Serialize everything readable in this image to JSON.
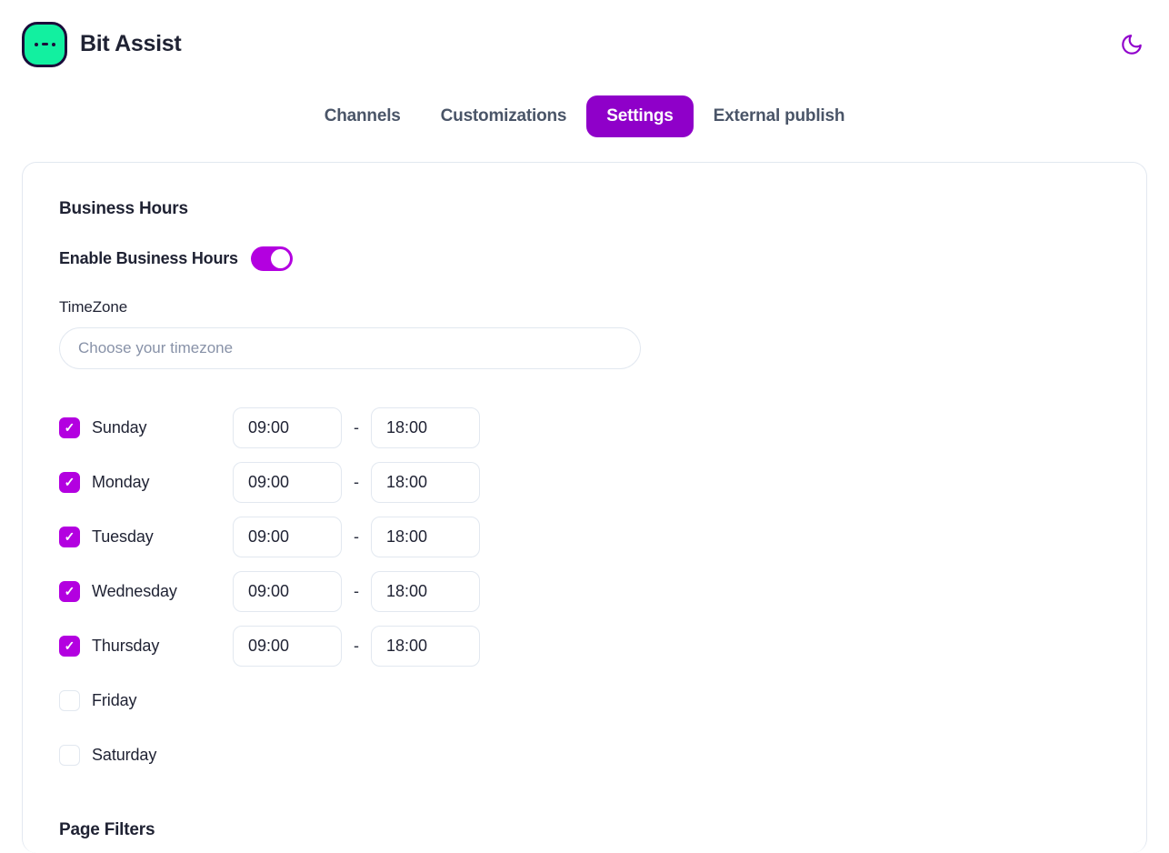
{
  "header": {
    "brand_name": "Bit Assist",
    "logo_icon": "bit-assist-logo-icon",
    "theme_toggle_icon": "moon-icon"
  },
  "tabs": [
    {
      "label": "Channels",
      "active": false
    },
    {
      "label": "Customizations",
      "active": false
    },
    {
      "label": "Settings",
      "active": true
    },
    {
      "label": "External publish",
      "active": false
    }
  ],
  "business_hours": {
    "section_title": "Business Hours",
    "enable_label": "Enable Business Hours",
    "enabled": true,
    "timezone_label": "TimeZone",
    "timezone_value": "",
    "timezone_placeholder": "Choose your timezone",
    "time_separator": "-",
    "days": [
      {
        "name": "Sunday",
        "checked": true,
        "start": "09:00",
        "end": "18:00"
      },
      {
        "name": "Monday",
        "checked": true,
        "start": "09:00",
        "end": "18:00"
      },
      {
        "name": "Tuesday",
        "checked": true,
        "start": "09:00",
        "end": "18:00"
      },
      {
        "name": "Wednesday",
        "checked": true,
        "start": "09:00",
        "end": "18:00"
      },
      {
        "name": "Thursday",
        "checked": true,
        "start": "09:00",
        "end": "18:00"
      },
      {
        "name": "Friday",
        "checked": false,
        "start": "",
        "end": ""
      },
      {
        "name": "Saturday",
        "checked": false,
        "start": "",
        "end": ""
      }
    ]
  },
  "page_filters": {
    "section_title": "Page Filters"
  },
  "colors": {
    "accent_purple": "#8f00c9",
    "toggle_purple": "#b300e0",
    "logo_green": "#12f0a0",
    "logo_outline": "#1b0b3a",
    "text_dark": "#1f2233",
    "text_muted": "#4a5568",
    "border": "#e2e8f0",
    "placeholder": "#8892a8"
  }
}
